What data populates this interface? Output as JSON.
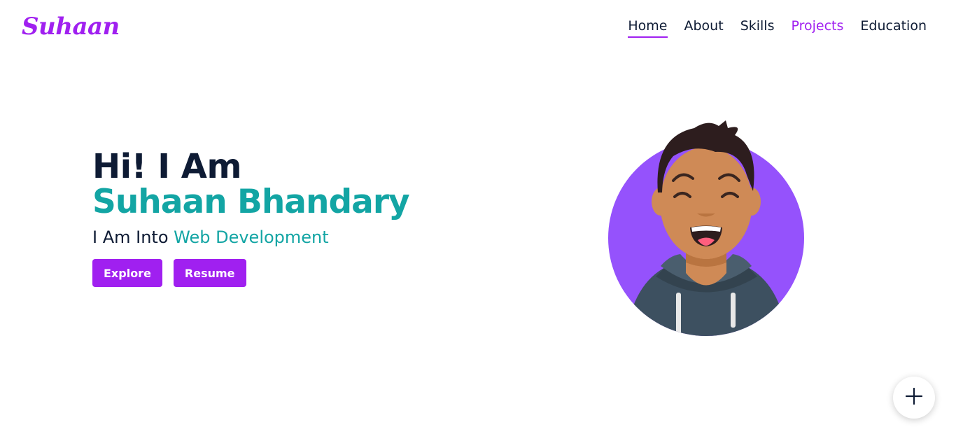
{
  "header": {
    "logo": "Suhaan",
    "nav": [
      {
        "label": "Home",
        "active": true
      },
      {
        "label": "About"
      },
      {
        "label": "Skills"
      },
      {
        "label": "Projects",
        "highlighted": true
      },
      {
        "label": "Education"
      }
    ]
  },
  "hero": {
    "greeting": "Hi! I Am",
    "name": "Suhaan Bhandary",
    "tagline_prefix": "I Am Into",
    "tagline_accent": "Web Development",
    "buttons": {
      "explore": "Explore",
      "resume": "Resume"
    },
    "avatar_icon": "cartoon-avatar-illustration"
  },
  "fab": {
    "icon": "plus-icon"
  },
  "colors": {
    "primary": "#a020f0",
    "accent": "#13a5a4",
    "text": "#0e1b34",
    "avatar_bg": "#9552fc"
  }
}
